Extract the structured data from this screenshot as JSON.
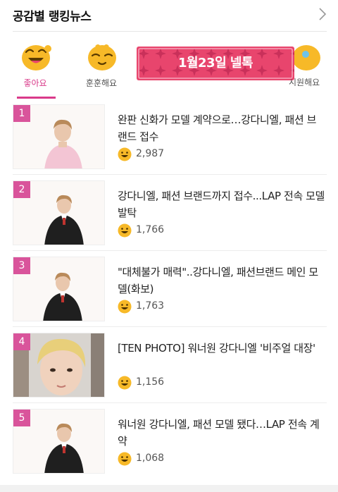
{
  "header": {
    "title": "공감별 랭킹뉴스",
    "more_icon": "chevron-right-icon"
  },
  "tabs": [
    {
      "label": "좋아요",
      "icon": "happy-face-icon",
      "active": true
    },
    {
      "label": "훈훈해요",
      "icon": "warm-face-icon",
      "active": false
    },
    {
      "label": "",
      "icon": "",
      "active": false
    },
    {
      "label": "",
      "icon": "",
      "active": false
    },
    {
      "label": "",
      "icon": "",
      "active": false
    }
  ],
  "banner": {
    "text": "1월23일 넬톡",
    "tail_label": "시원해요"
  },
  "articles": [
    {
      "rank": "1",
      "title": "완판 신화가 모델 계약으로…강다니엘, 패션 브랜드 접수",
      "count": "2,987"
    },
    {
      "rank": "2",
      "title": "강다니엘, 패션 브랜드까지 접수...LAP 전속 모델 발탁",
      "count": "1,766"
    },
    {
      "rank": "3",
      "title": "\"대체불가 매력\"..강다니엘, 패션브랜드 메인 모델(화보)",
      "count": "1,763"
    },
    {
      "rank": "4",
      "title": "[TEN PHOTO] 워너원 강다니엘 '비주얼 대장'",
      "count": "1,156"
    },
    {
      "rank": "5",
      "title": "워너원 강다니엘, 패션 모델 됐다…LAP 전속 계약",
      "count": "1,068"
    }
  ],
  "colors": {
    "accent": "#d93a8a",
    "rank_badge": "#d9549b",
    "banner": "#e8456d",
    "emoji": "#f7b928"
  }
}
